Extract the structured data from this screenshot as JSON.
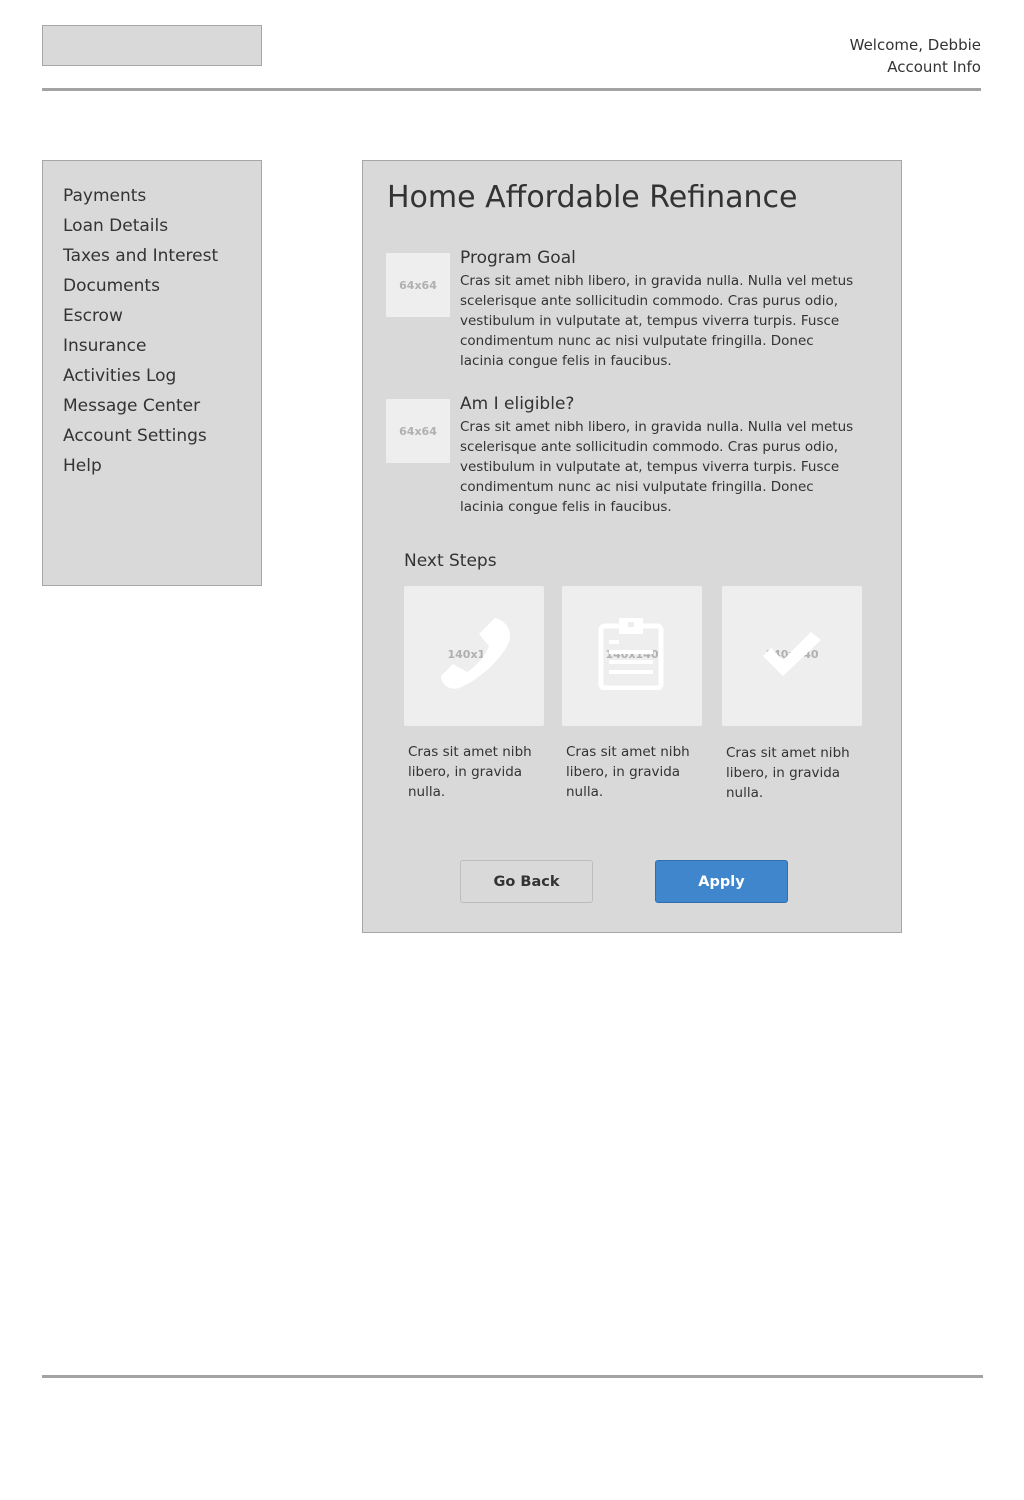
{
  "header": {
    "welcome": "Welcome, Debbie",
    "account_link": "Account Info"
  },
  "sidebar": {
    "items": [
      {
        "label": "Payments"
      },
      {
        "label": "Loan Details"
      },
      {
        "label": "Taxes and Interest"
      },
      {
        "label": "Documents"
      },
      {
        "label": "Escrow"
      },
      {
        "label": "Insurance"
      },
      {
        "label": "Activities Log"
      },
      {
        "label": "Message Center"
      },
      {
        "label": "Account Settings"
      },
      {
        "label": "Help"
      }
    ]
  },
  "main": {
    "title": "Home Affordable Refinance",
    "features": [
      {
        "thumb_label": "64x64",
        "title": "Program Goal",
        "text": "Cras sit amet nibh libero, in gravida nulla. Nulla vel metus scelerisque ante sollicitudin commodo. Cras purus odio, vestibulum in vulputate at, tempus viverra turpis. Fusce condimentum nunc ac nisi vulputate fringilla. Donec lacinia congue felis in faucibus."
      },
      {
        "thumb_label": "64x64",
        "title": "Am I eligible?",
        "text": "Cras sit amet nibh libero, in gravida nulla. Nulla vel metus scelerisque ante sollicitudin commodo. Cras purus odio, vestibulum in vulputate at, tempus viverra turpis. Fusce condimentum nunc ac nisi vulputate fringilla. Donec lacinia congue felis in faucibus."
      }
    ],
    "next_steps": {
      "title": "Next Steps",
      "steps": [
        {
          "icon": "phone-icon",
          "placeholder": "140x140",
          "text": "Cras sit amet nibh libero, in gravida nulla."
        },
        {
          "icon": "clipboard-icon",
          "placeholder": "140x140",
          "text": "Cras sit amet nibh libero, in gravida nulla."
        },
        {
          "icon": "checkmark-icon",
          "placeholder": "140x140",
          "text": "Cras sit amet nibh libero, in gravida nulla."
        }
      ]
    },
    "buttons": {
      "back_label": "Go Back",
      "apply_label": "Apply"
    }
  },
  "colors": {
    "panel_bg": "#d9d9d9",
    "accent": "#3f86cc",
    "text": "#333333"
  }
}
